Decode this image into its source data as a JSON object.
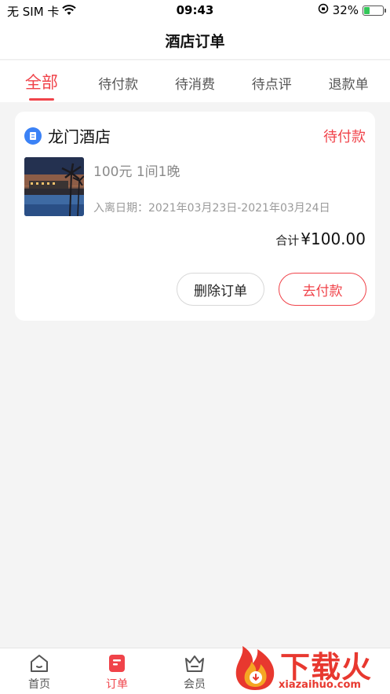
{
  "status_bar": {
    "carrier": "无 SIM 卡",
    "time": "09:43",
    "battery_percent": "32%",
    "battery_level": 0.32
  },
  "nav": {
    "title": "酒店订单"
  },
  "tabs": [
    {
      "label": "全部",
      "active": true
    },
    {
      "label": "待付款",
      "active": false
    },
    {
      "label": "待消费",
      "active": false
    },
    {
      "label": "待点评",
      "active": false
    },
    {
      "label": "退款单",
      "active": false
    }
  ],
  "order": {
    "hotel_name": "龙门酒店",
    "status": "待付款",
    "room_info": "100元 1间1晚",
    "stay_dates": "入离日期：2021年03月23日-2021年03月24日",
    "total_label": "合计",
    "total_value": "¥100.00",
    "delete_label": "删除订单",
    "pay_label": "去付款"
  },
  "tab_bar": {
    "items": [
      {
        "label": "首页",
        "icon": "home-icon",
        "active": false
      },
      {
        "label": "订单",
        "icon": "order-icon",
        "active": true
      },
      {
        "label": "会员",
        "icon": "member-icon",
        "active": false
      }
    ]
  },
  "watermark": {
    "text": "下载火",
    "url": "xiazaihuo.com"
  },
  "colors": {
    "accent": "#f0434a",
    "hotel_icon": "#3b82f6",
    "background": "#f4f4f4"
  }
}
